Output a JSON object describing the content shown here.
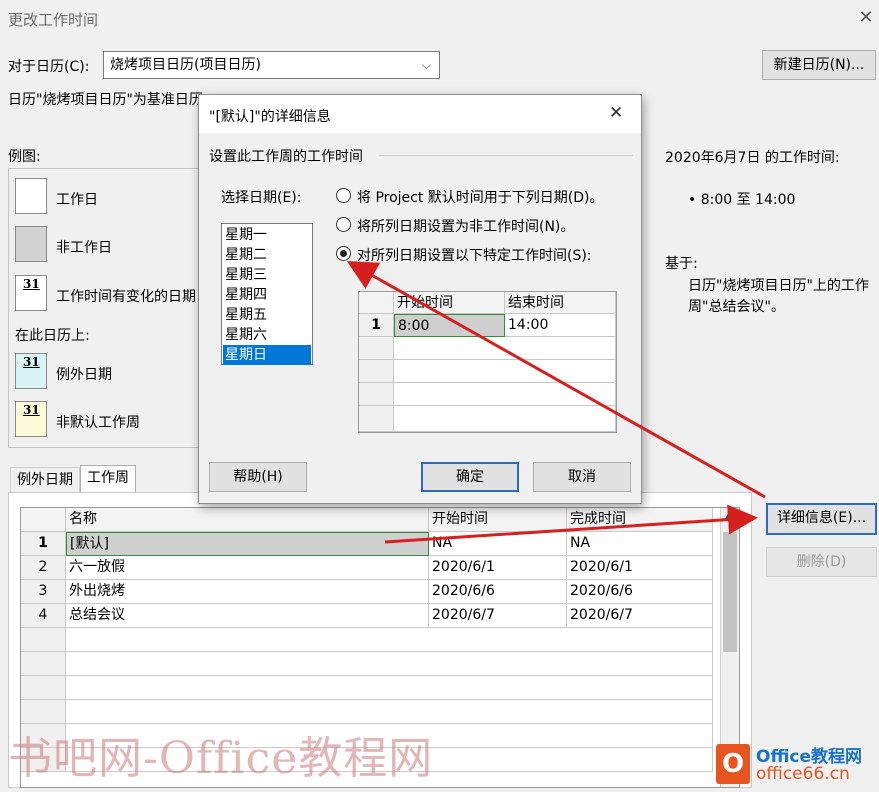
{
  "window": {
    "title": "更改工作时间"
  },
  "calendar": {
    "label": "对于日历(C):",
    "selected": "烧烤项目日历(项目日历)",
    "new_button": "新建日历(N)...",
    "base_note": "日历\"烧烤项目日历\"为基准日历"
  },
  "legend": {
    "title": "例图:",
    "working": "工作日",
    "nonworking": "非工作日",
    "changed": "工作时间有变化的日期",
    "on_calendar": "在此日历上:",
    "exception": "例外日期",
    "nondefault": "非默认工作周",
    "day_number": "31"
  },
  "info": {
    "date_title": "2020年6月7日 的工作时间:",
    "time_bullet": "• 8:00 至 14:00",
    "based_on": "基于:",
    "based_desc": "日历\"烧烤项目日历\"上的工作周\"总结会议\"。"
  },
  "tabs": [
    "例外日期",
    "工作周"
  ],
  "table": {
    "headers": [
      "名称",
      "开始时间",
      "完成时间"
    ],
    "rows": [
      {
        "num": "1",
        "name": "[默认]",
        "start": "NA",
        "end": "NA"
      },
      {
        "num": "2",
        "name": "六一放假",
        "start": "2020/6/1",
        "end": "2020/6/1"
      },
      {
        "num": "3",
        "name": "外出烧烤",
        "start": "2020/6/6",
        "end": "2020/6/6"
      },
      {
        "num": "4",
        "name": "总结会议",
        "start": "2020/6/7",
        "end": "2020/6/7"
      }
    ]
  },
  "side_buttons": {
    "details": "详细信息(E)...",
    "delete": "删除(D)"
  },
  "dialog": {
    "title": "\"[默认]\"的详细信息",
    "section": "设置此工作周的工作时间",
    "select_label": "选择日期(E):",
    "days": [
      "星期一",
      "星期二",
      "星期三",
      "星期四",
      "星期五",
      "星期六",
      "星期日"
    ],
    "selected_day": "星期日",
    "options": [
      "将 Project 默认时间用于下列日期(D)。",
      "将所列日期设置为非工作时间(N)。",
      "对所列日期设置以下特定工作时间(S):"
    ],
    "selected_option": 2,
    "time_headers": [
      "开始时间",
      "结束时间"
    ],
    "time_rows": [
      {
        "num": "1",
        "start": "8:00",
        "end": "14:00"
      }
    ],
    "help": "帮助(H)",
    "ok": "确定",
    "cancel": "取消"
  },
  "watermark": {
    "text": "书吧网-Office教程网",
    "logo_brand": "Office教程网",
    "logo_url": "office66.cn"
  },
  "colors": {
    "accent": "#0078d7",
    "arrow": "#d62020",
    "exception": "#d8f4f4",
    "nondefault": "#fbfbd8"
  }
}
